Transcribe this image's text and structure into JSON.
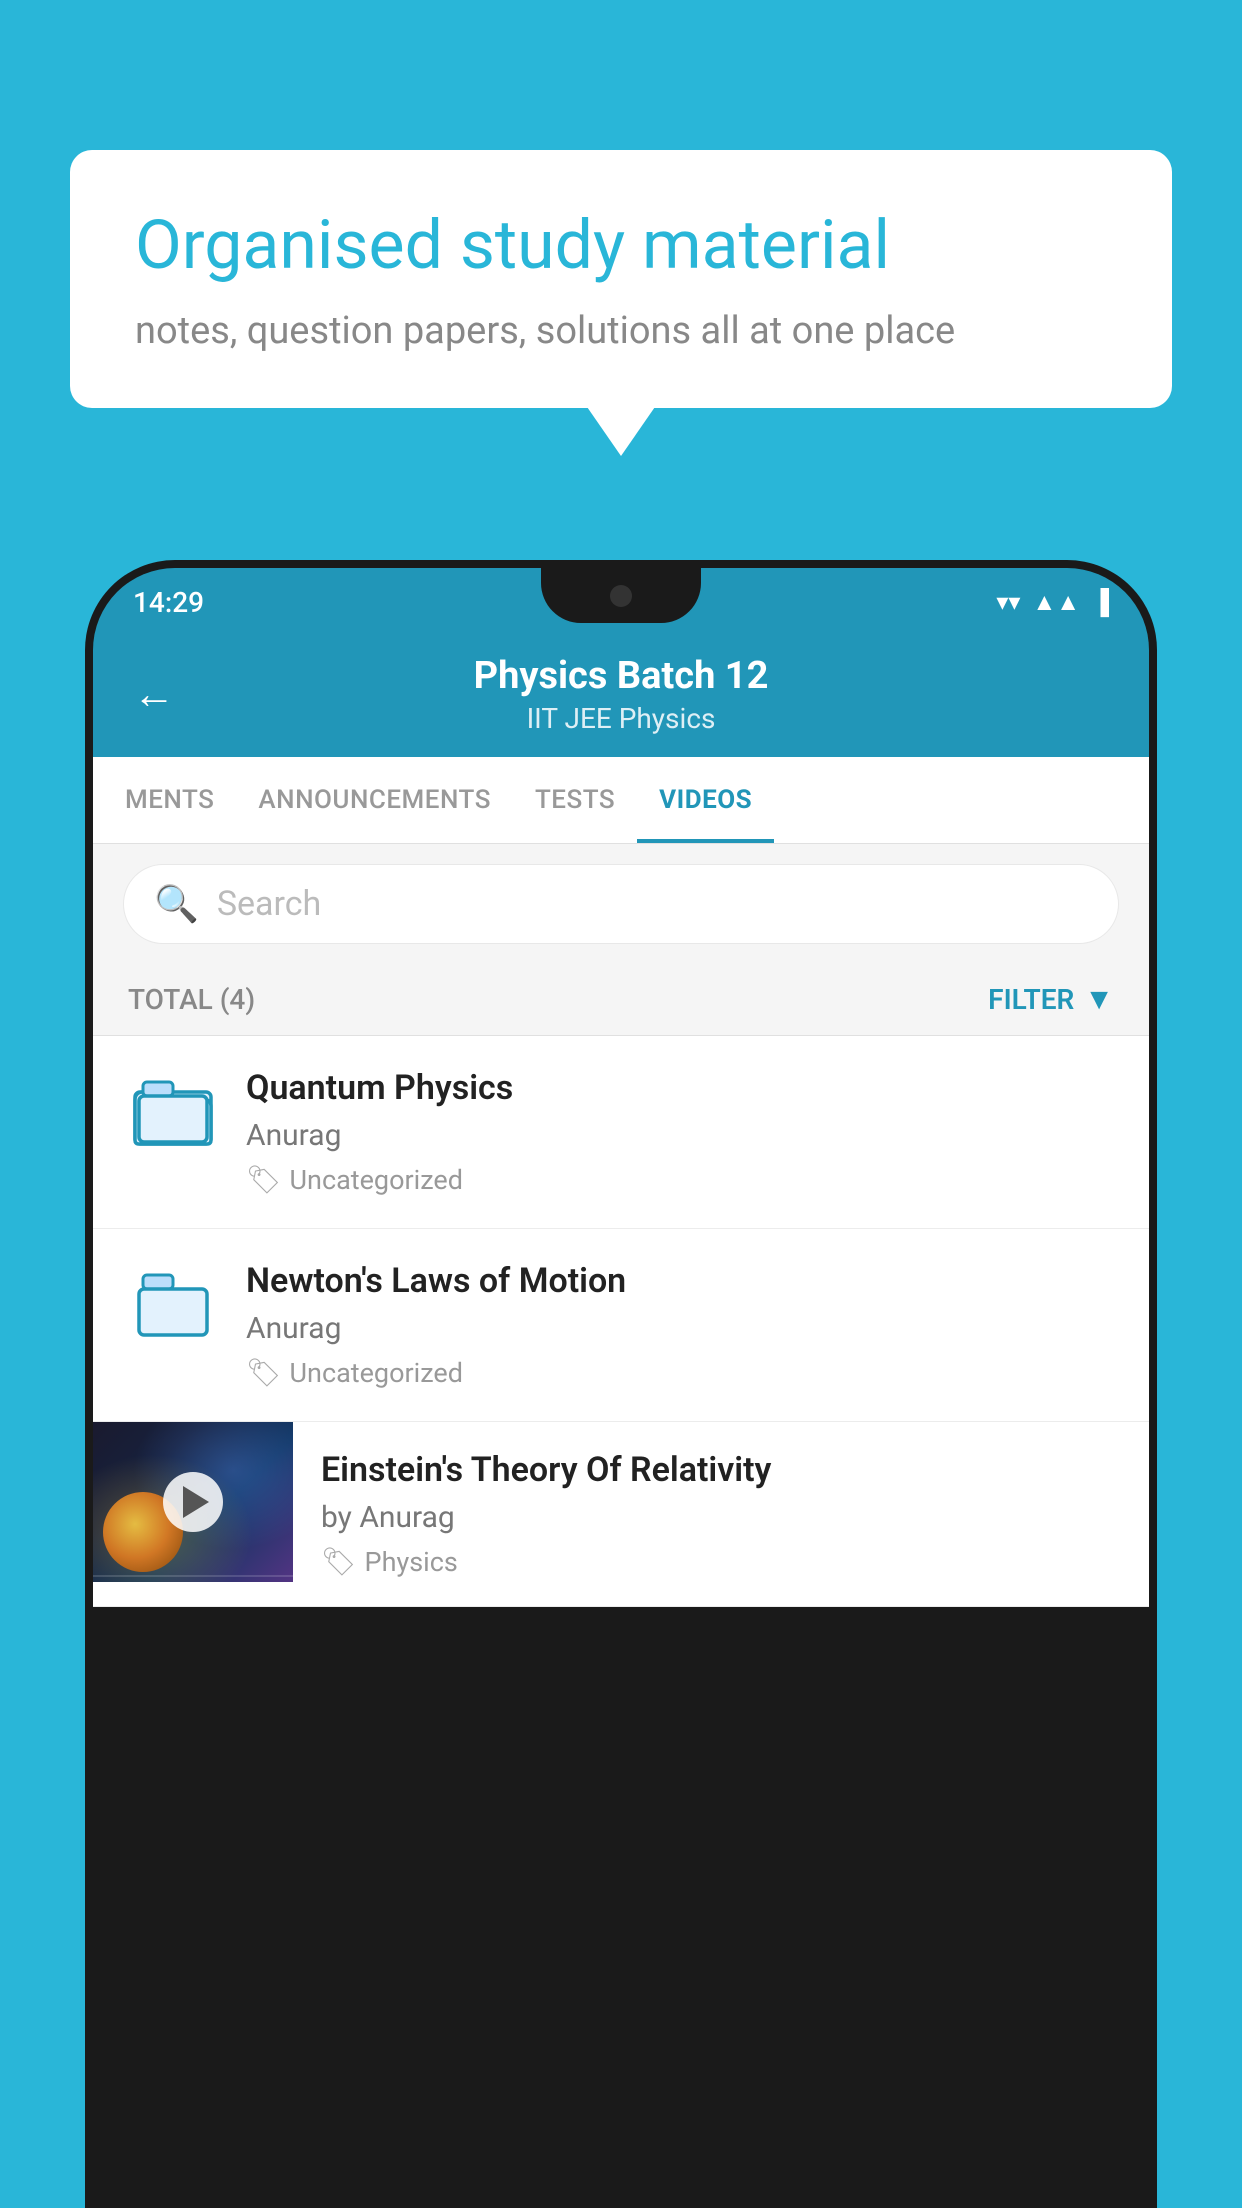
{
  "background_color": "#29b6d8",
  "bubble": {
    "title": "Organised study material",
    "subtitle": "notes, question papers, solutions all at one place"
  },
  "status_bar": {
    "time": "14:29",
    "wifi": "▲",
    "signal": "▲",
    "battery": "▮"
  },
  "header": {
    "title": "Physics Batch 12",
    "subtitle": "IIT JEE    Physics",
    "back_label": "←"
  },
  "tabs": [
    {
      "label": "MENTS",
      "active": false
    },
    {
      "label": "ANNOUNCEMENTS",
      "active": false
    },
    {
      "label": "TESTS",
      "active": false
    },
    {
      "label": "VIDEOS",
      "active": true
    }
  ],
  "search": {
    "placeholder": "Search"
  },
  "filter_bar": {
    "total_label": "TOTAL (4)",
    "filter_label": "FILTER"
  },
  "items": [
    {
      "type": "folder",
      "title": "Quantum Physics",
      "author": "Anurag",
      "tag": "Uncategorized"
    },
    {
      "type": "folder",
      "title": "Newton's Laws of Motion",
      "author": "Anurag",
      "tag": "Uncategorized"
    },
    {
      "type": "video",
      "title": "Einstein's Theory Of Relativity",
      "author": "by Anurag",
      "tag": "Physics"
    }
  ]
}
